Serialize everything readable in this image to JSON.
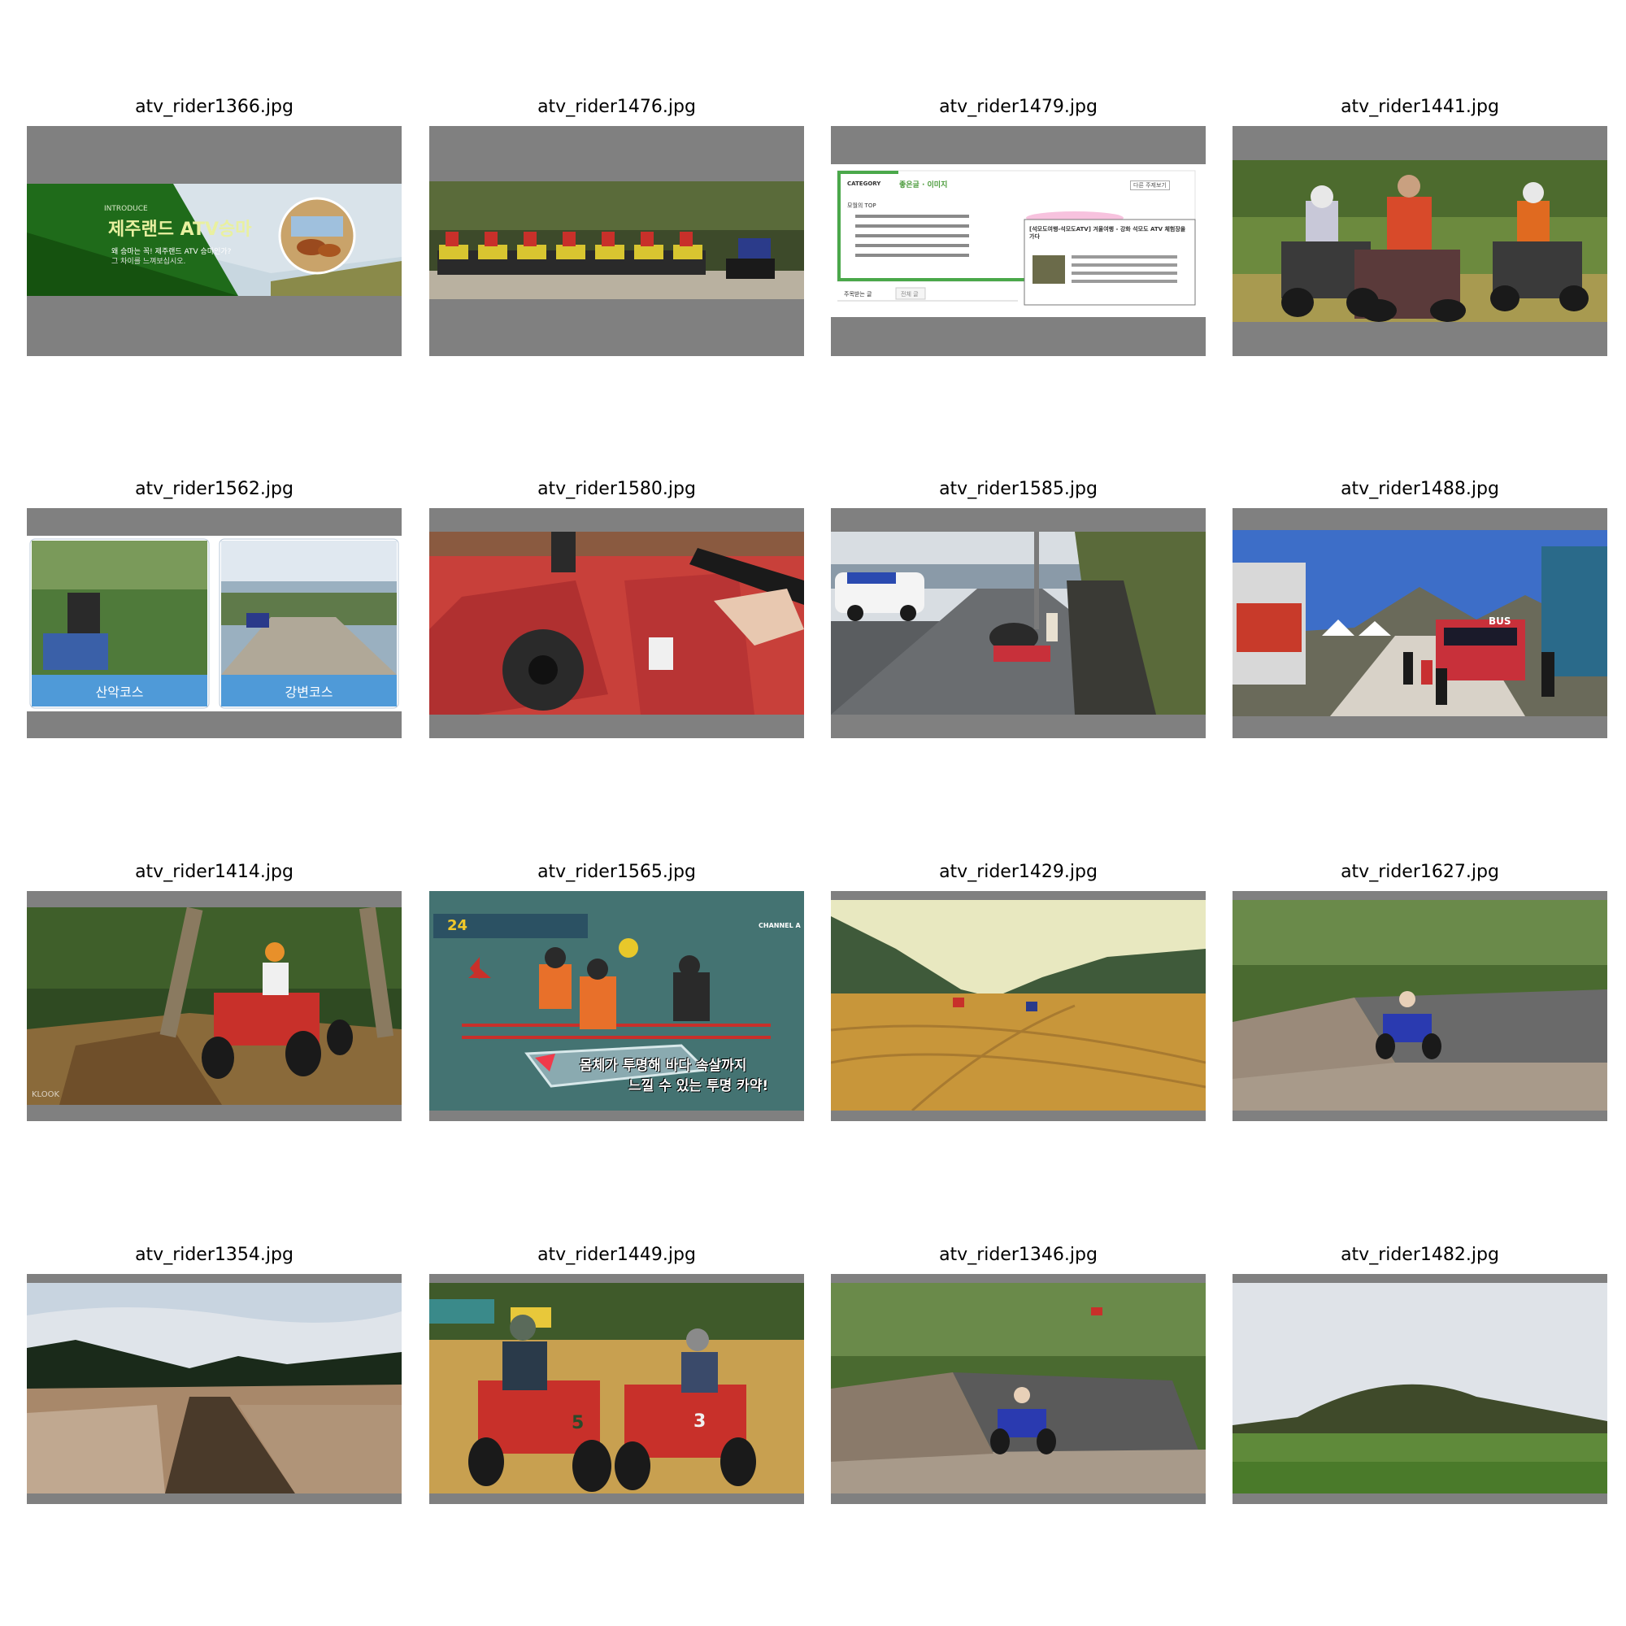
{
  "images": [
    {
      "filename": "atv_rider1366.jpg",
      "subject": "jeju-land-atv-banner",
      "overlay_lines": [
        "INTRODUCE",
        "제주랜드 ATV승마",
        "왜 승마는 꼭! 제주랜드 ATV 승마인가?",
        "그 차이를 느껴보십시오."
      ]
    },
    {
      "filename": "atv_rider1476.jpg",
      "subject": "atv-lineup-forest"
    },
    {
      "filename": "atv_rider1479.jpg",
      "subject": "blog-category-screenshot",
      "overlay_lines": [
        "CATEGORY",
        "좋은글 · 이미지",
        "모월의 TOP",
        "주목받는 글",
        "전체 글",
        "[석모도여행-석모도ATV] 겨울여행 - 강화 석모도 ATV 체험장을 가다",
        "다른 주제보기"
      ]
    },
    {
      "filename": "atv_rider1441.jpg",
      "subject": "three-riders-field"
    },
    {
      "filename": "atv_rider1562.jpg",
      "subject": "course-panels",
      "overlay_lines": [
        "산악코스",
        "강변코스"
      ]
    },
    {
      "filename": "atv_rider1580.jpg",
      "subject": "red-atv-handlebar-closeup"
    },
    {
      "filename": "atv_rider1585.jpg",
      "subject": "overturned-atv-road"
    },
    {
      "filename": "atv_rider1488.jpg",
      "subject": "festival-street-bus",
      "overlay_lines": [
        "BUS"
      ]
    },
    {
      "filename": "atv_rider1414.jpg",
      "subject": "red-atv-jungle-trail",
      "overlay_lines": [
        "KLOOK"
      ]
    },
    {
      "filename": "atv_rider1565.jpg",
      "subject": "clear-kayak-tv",
      "overlay_lines": [
        "24",
        "CHANNEL A",
        "몸체가 투명해 바다 속살까지",
        "느낄 수 있는 투명 카약!"
      ]
    },
    {
      "filename": "atv_rider1429.jpg",
      "subject": "dirt-field-valley"
    },
    {
      "filename": "atv_rider1627.jpg",
      "subject": "blue-atv-stream-forest"
    },
    {
      "filename": "atv_rider1354.jpg",
      "subject": "silver-grass-trail"
    },
    {
      "filename": "atv_rider1449.jpg",
      "subject": "two-red-atvs-family",
      "overlay_lines": [
        "5",
        "3"
      ]
    },
    {
      "filename": "atv_rider1346.jpg",
      "subject": "blue-atv-creek"
    },
    {
      "filename": "atv_rider1482.jpg",
      "subject": "green-hill-meadow"
    }
  ]
}
